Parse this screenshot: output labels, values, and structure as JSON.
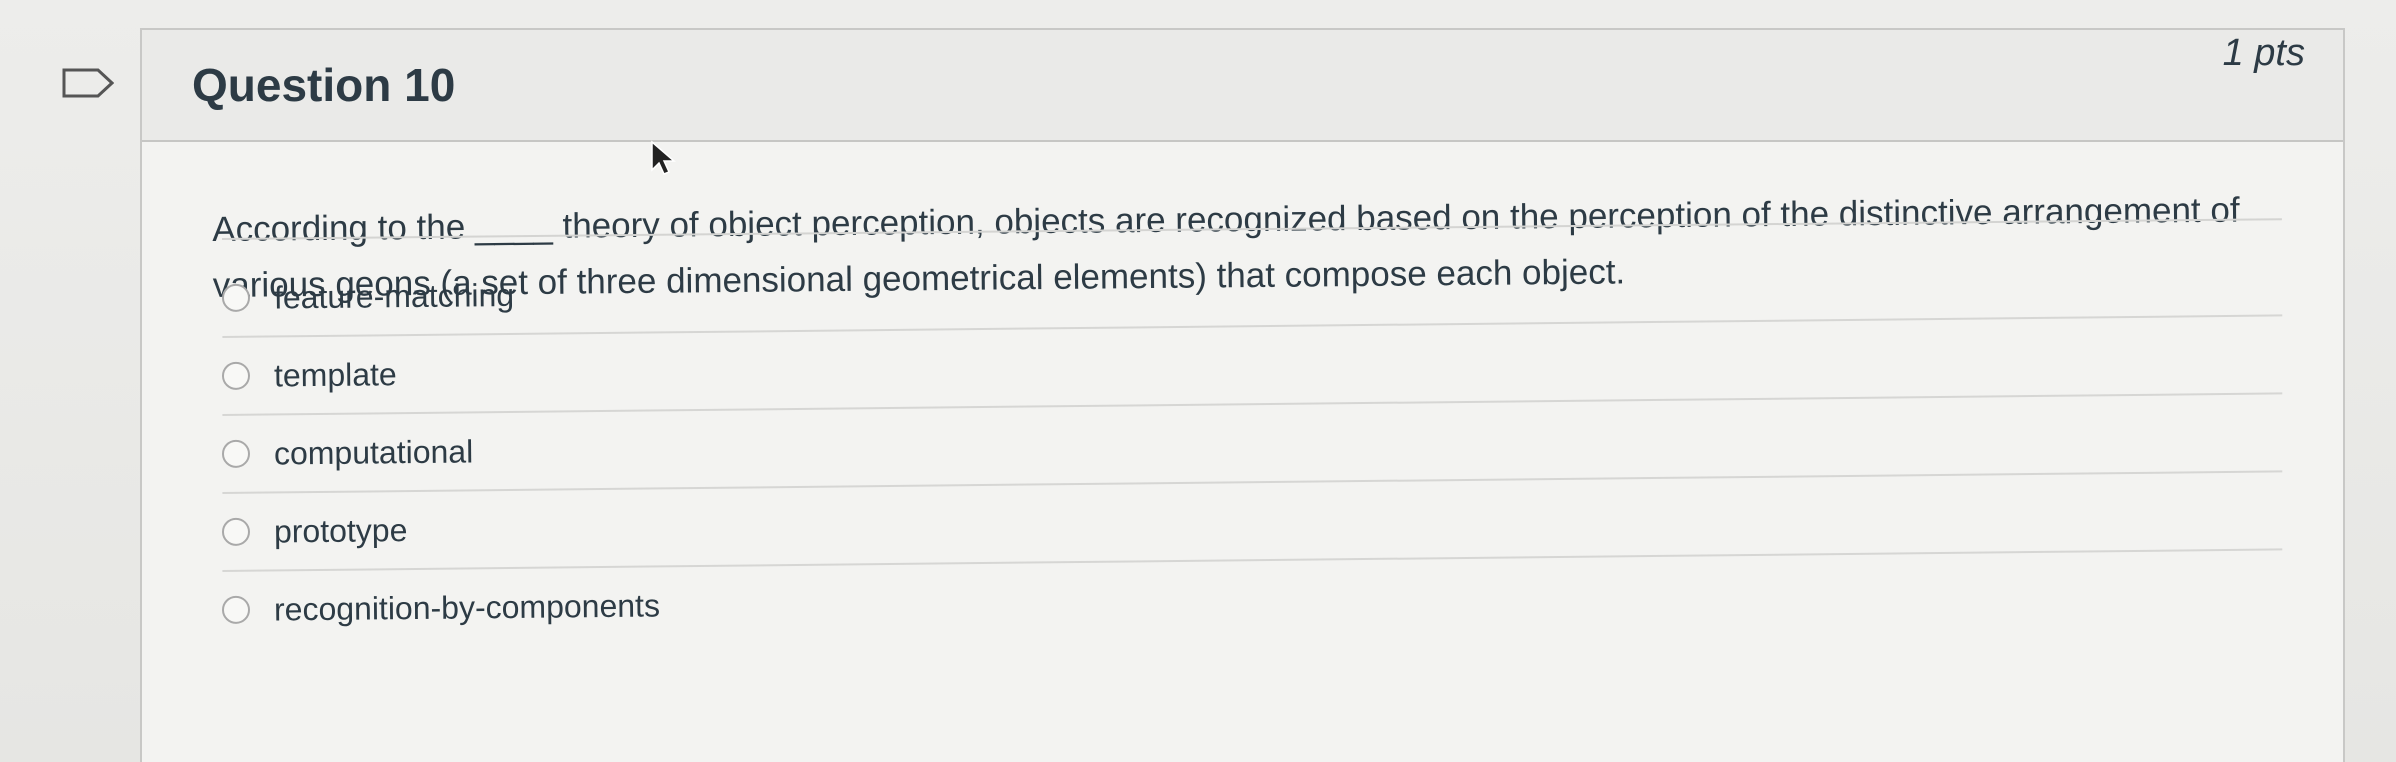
{
  "question": {
    "title": "Question 10",
    "points": "1 pts",
    "text": "According to the ____ theory of object perception, objects are recognized based on the perception of the distinctive arrangement of various geons (a set of three dimensional geometrical elements) that compose each object.",
    "flag_icon": "flag-outline-icon"
  },
  "answers": [
    {
      "label": "feature-matching"
    },
    {
      "label": "template"
    },
    {
      "label": "computational"
    },
    {
      "label": "prototype"
    },
    {
      "label": "recognition-by-components"
    }
  ],
  "colors": {
    "text": "#2d3b45",
    "background": "#e9e9e7",
    "card": "#f3f3f1",
    "border": "#c8c8c6"
  }
}
